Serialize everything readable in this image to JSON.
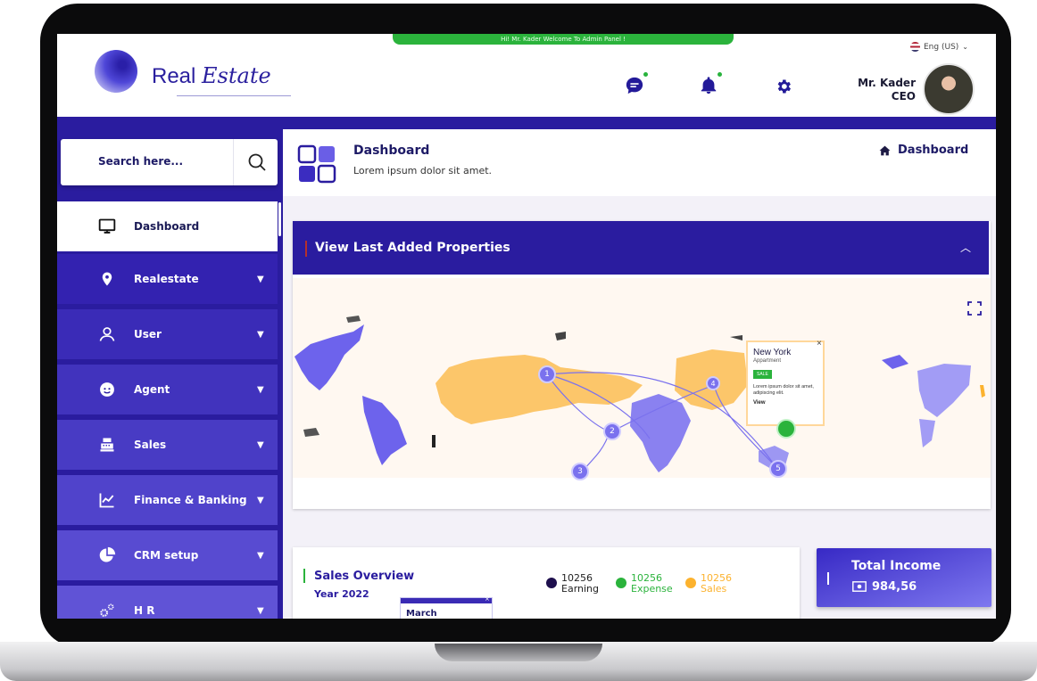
{
  "header": {
    "welcome": "Hi! Mr. Kader Welcome To Admin Panel !",
    "logo_word1": "Real",
    "logo_word2": "Estate",
    "language": "Eng (US)",
    "user_name": "Mr. Kader",
    "user_role": "CEO"
  },
  "sidebar": {
    "search_placeholder": "Search here...",
    "items": [
      {
        "label": "Dashboard",
        "icon": "monitor-icon",
        "active": true
      },
      {
        "label": "Realestate",
        "icon": "map-pin-icon"
      },
      {
        "label": "User",
        "icon": "user-icon"
      },
      {
        "label": "Agent",
        "icon": "agent-icon"
      },
      {
        "label": "Sales",
        "icon": "cash-register-icon"
      },
      {
        "label": "Finance & Banking",
        "icon": "chart-line-icon"
      },
      {
        "label": "CRM setup",
        "icon": "pie-chart-icon"
      },
      {
        "label": "H R",
        "icon": "gears-icon"
      }
    ]
  },
  "page_header": {
    "title": "Dashboard",
    "subtitle": "Lorem ipsum dolor sit amet.",
    "breadcrumb": "Dashboard"
  },
  "properties_card": {
    "title": "View Last Added Properties",
    "pins": [
      "1",
      "2",
      "3",
      "4",
      "5"
    ],
    "popup": {
      "city": "New York",
      "type": "Appartment",
      "badge": "SALE",
      "description": "Lorem ipsum dolor sit amet, adipiscing elit.",
      "link": "View"
    }
  },
  "sales_overview": {
    "title": "Sales Overview",
    "year": "Year 2022",
    "month": "March",
    "legend": [
      {
        "value": "10256",
        "label": "Earning",
        "color": "#1e0f4d"
      },
      {
        "value": "10256",
        "label": "Expense",
        "color": "#2bb33c"
      },
      {
        "value": "10256",
        "label": "Sales",
        "color": "#fcb22e"
      }
    ]
  },
  "income": {
    "title": "Total Income",
    "value": "984,56"
  },
  "colors": {
    "primary": "#2a1c9f",
    "accent_green": "#2bb33c",
    "accent_orange": "#fcb22e",
    "map_purple": "#7a71ee",
    "map_yellow": "#fcc66a"
  }
}
